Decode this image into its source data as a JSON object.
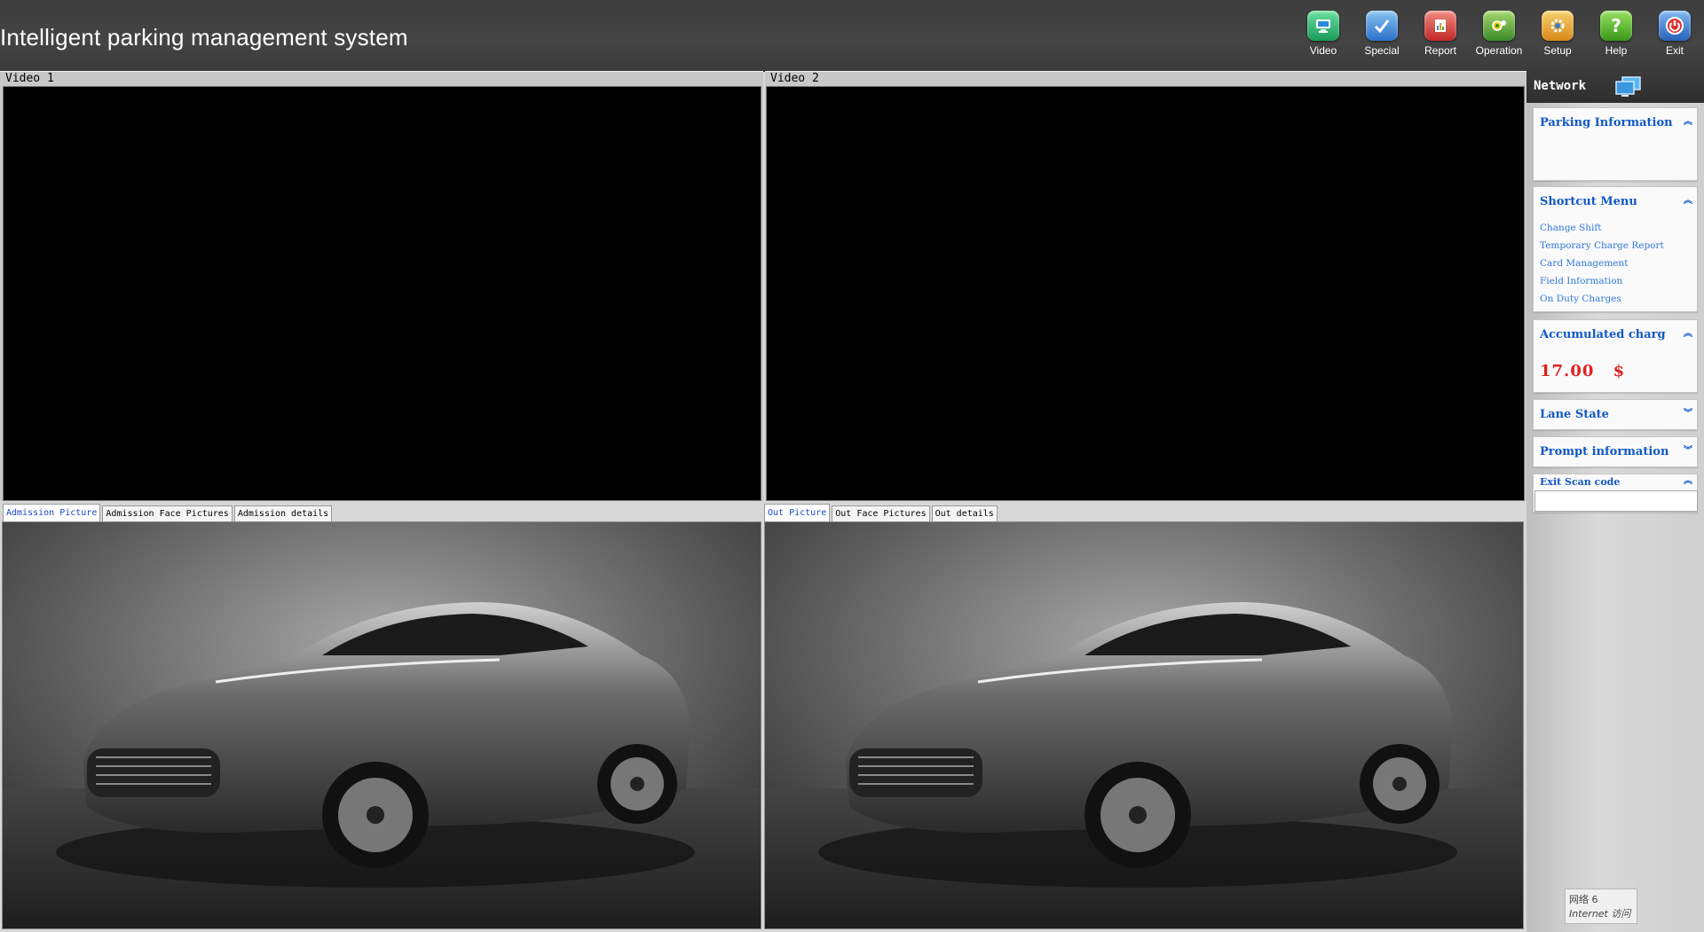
{
  "header": {
    "title": "Intelligent parking management system",
    "toolbar": [
      {
        "label": "Video",
        "icon": "monitor-icon",
        "color": "#2fb86a"
      },
      {
        "label": "Special",
        "icon": "special-check-icon",
        "color": "#3a88d8"
      },
      {
        "label": "Report",
        "icon": "report-chart-icon",
        "color": "#d84040"
      },
      {
        "label": "Operation",
        "icon": "operation-gear-icon",
        "color": "#5ca83a"
      },
      {
        "label": "Setup",
        "icon": "setup-gear-icon",
        "color": "#e8a830"
      },
      {
        "label": "Help",
        "icon": "help-question-icon",
        "color": "#58b830"
      },
      {
        "label": "Exit",
        "icon": "exit-power-icon",
        "color": "#3a78c8"
      }
    ]
  },
  "video": {
    "left_title": "Video 1",
    "right_title": "Video 2"
  },
  "admission_tabs": [
    "Admission Picture",
    "Admission Face Pictures",
    "Admission details"
  ],
  "out_tabs": [
    "Out Picture",
    "Out Face Pictures",
    "Out details"
  ],
  "sidebar": {
    "network_label": "Network",
    "parking_info": {
      "title": "Parking Information"
    },
    "shortcut_menu": {
      "title": "Shortcut Menu",
      "items": [
        "Change Shift",
        "Temporary Charge Report",
        "Card Management",
        "Field Information",
        "On Duty Charges"
      ]
    },
    "accumulated": {
      "title": "Accumulated charg",
      "amount": "17.00",
      "currency": "$"
    },
    "lane_state": {
      "title": "Lane State"
    },
    "prompt_info": {
      "title": "Prompt information"
    },
    "exit_scan": {
      "title": "Exit Scan code",
      "value": ""
    },
    "network_tip": {
      "line1": "网络  6",
      "line2": "Internet 访问"
    }
  },
  "colors": {
    "accent_link": "#1058c8",
    "amount": "#e02020"
  }
}
